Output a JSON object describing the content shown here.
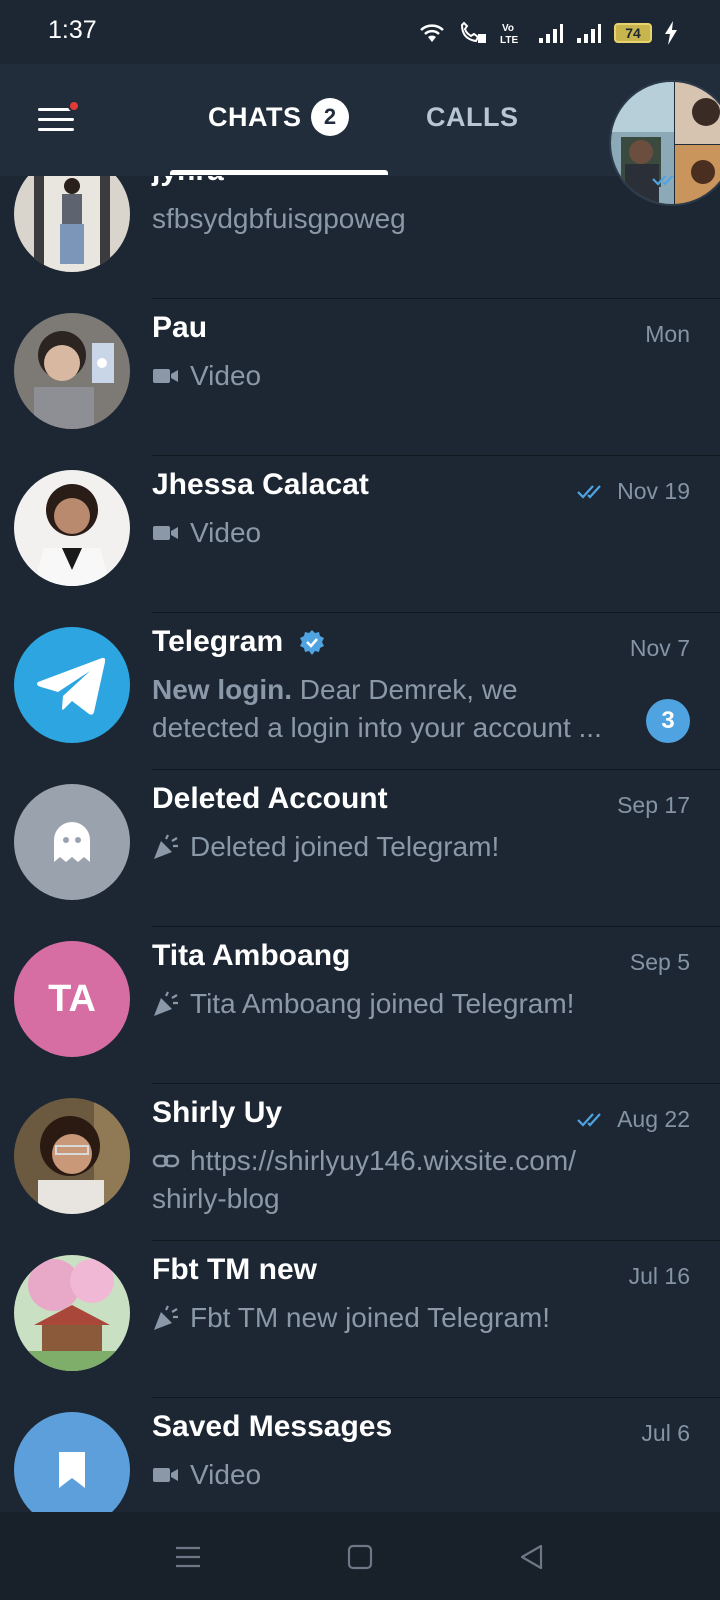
{
  "status_bar": {
    "time": "1:37",
    "battery": "74",
    "icons": [
      "wifi-icon",
      "wifi-calling-icon",
      "volte-icon",
      "signal-icon",
      "signal-icon",
      "battery-icon",
      "charging-icon"
    ]
  },
  "header": {
    "tabs": [
      {
        "label": "CHATS",
        "badge": "2",
        "active": true
      },
      {
        "label": "CALLS",
        "active": false
      }
    ],
    "menu_has_notification": true
  },
  "chats": [
    {
      "name": "jyhra",
      "message": "sfbsydgbfuisgpoweg",
      "date": "",
      "read": true,
      "avatar": "photo"
    },
    {
      "name": "Pau",
      "message": "Video",
      "date": "Mon",
      "message_icon": "video-icon",
      "avatar": "photo"
    },
    {
      "name": "Jhessa Calacat",
      "message": "Video",
      "date": "Nov 19",
      "read": true,
      "message_icon": "video-icon",
      "avatar": "photo"
    },
    {
      "name": "Telegram",
      "verified": true,
      "message_bold": "New login.",
      "message": " Dear Demrek, we",
      "message_line2": "detected a login into your account ...",
      "date": "Nov 7",
      "unread": "3",
      "avatar": "telegram-logo"
    },
    {
      "name": "Deleted Account",
      "message": "Deleted joined Telegram!",
      "date": "Sep 17",
      "message_icon": "party-icon",
      "avatar": "ghost-icon"
    },
    {
      "name": "Tita Amboang",
      "message": "Tita Amboang joined Telegram!",
      "date": "Sep 5",
      "message_icon": "party-icon",
      "avatar_initials": "TA"
    },
    {
      "name": "Shirly Uy",
      "message": "https://shirlyuy146.wixsite.com/",
      "message_line2": "shirly-blog",
      "date": "Aug 22",
      "read": true,
      "message_icon": "link-icon",
      "avatar": "photo"
    },
    {
      "name": "Fbt TM new",
      "message": "Fbt TM new joined Telegram!",
      "date": "Jul 16",
      "message_icon": "party-icon",
      "avatar": "photo"
    },
    {
      "name": "Saved Messages",
      "message": "Video",
      "date": "Jul 6",
      "message_icon": "video-icon",
      "avatar": "bookmark-icon"
    }
  ],
  "colors": {
    "background": "#1d2733",
    "header": "#212d3b",
    "accent": "#4fa3e0",
    "telegram_blue": "#2ca5e0",
    "initials_avatar": "#d66ea3",
    "ghost_avatar": "#9aa3ad"
  }
}
